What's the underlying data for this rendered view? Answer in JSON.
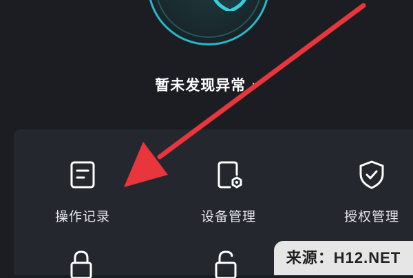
{
  "status": {
    "text": "暂未发现异常",
    "chevron": "›"
  },
  "tiles": [
    {
      "label": "操作记录",
      "icon": "document-icon"
    },
    {
      "label": "设备管理",
      "icon": "device-settings-icon"
    },
    {
      "label": "授权管理",
      "icon": "shield-check-icon"
    },
    {
      "label": "",
      "icon": "lock-icon"
    },
    {
      "label": "",
      "icon": "unlock-icon"
    }
  ],
  "watermark": {
    "text": "来源：H12.NET"
  },
  "colors": {
    "background": "#1c1d23",
    "panel": "#25272e",
    "accent_cyan": "#2bb8c9",
    "annotation_arrow": "#e8363c"
  }
}
